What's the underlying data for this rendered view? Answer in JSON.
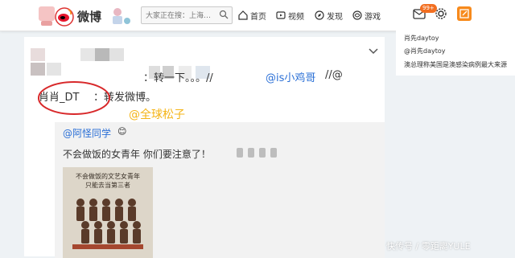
{
  "header": {
    "logo_text": "微博",
    "search_placeholder": "大家正在搜：上海…",
    "nav": [
      "首页",
      "视频",
      "发现",
      "游戏"
    ],
    "msg_badge": "99+"
  },
  "sidebar": {
    "lines": [
      "肖先daytoy",
      "@肖先daytoy",
      "澳总理称美国是澳感染病例最大来源"
    ]
  },
  "post": {
    "forward_suffix": "：转一下。。。//",
    "mention_1": "@is小鸡哥",
    "mention_2": "//@",
    "repost_user": "肖肖_DT",
    "repost_text": "：转发微博。",
    "overlay_text": "@全球松子",
    "inner": {
      "author": "@阿怪同学",
      "text": "不会做饭的女青年 你们要注意了！",
      "image_caption_1": "不会做饭的文艺女青年",
      "image_caption_2": "只能去当第三者"
    }
  },
  "watermark": "快传号 / 零距离YULE",
  "colors": {
    "accent_orange": "#f78a1c",
    "link_blue": "#2a6fd6",
    "overlay_yellow": "#f4b417"
  }
}
